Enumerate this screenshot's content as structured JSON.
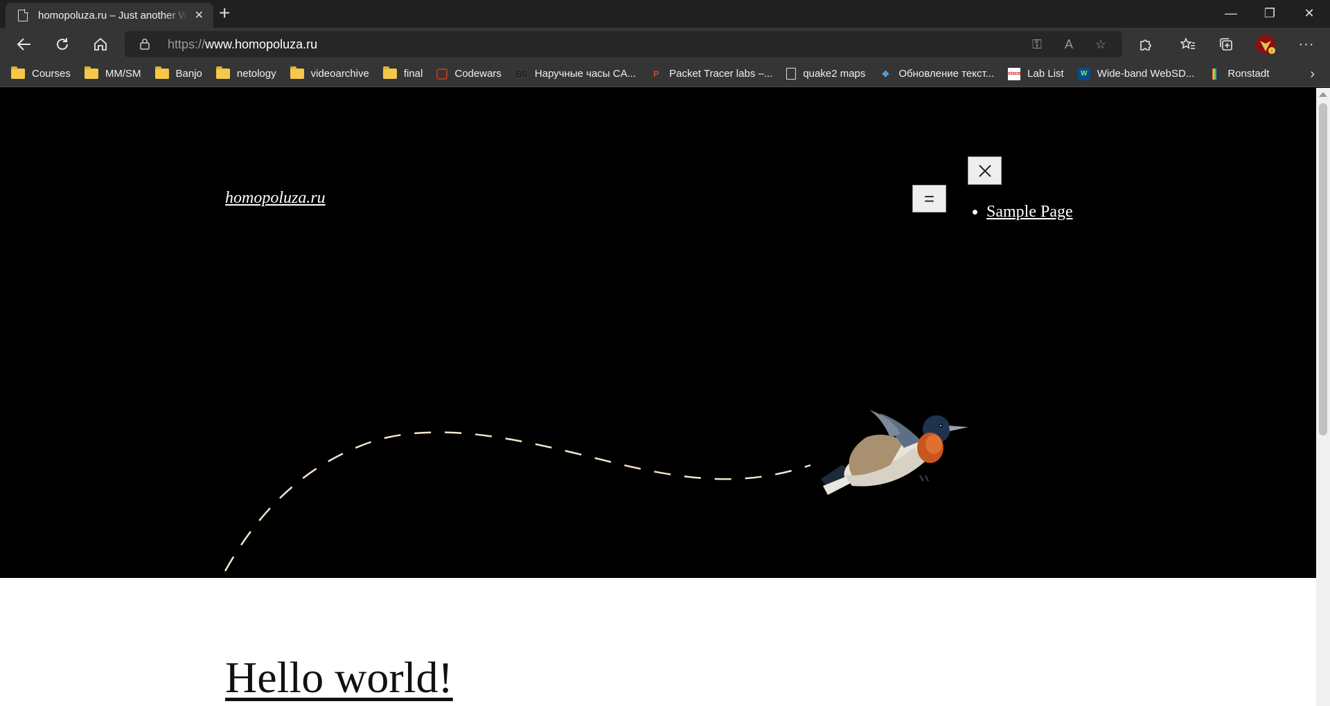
{
  "browser": {
    "tab": {
      "title": "homopoluza.ru – Just another WordPress site"
    },
    "url": {
      "protocol": "https://",
      "host": "www.homopoluza.ru"
    },
    "bookmarks": [
      {
        "label": "Courses",
        "icon": "folder-icon"
      },
      {
        "label": "MM/SM",
        "icon": "folder-icon"
      },
      {
        "label": "Banjo",
        "icon": "folder-icon"
      },
      {
        "label": "netology",
        "icon": "folder-icon"
      },
      {
        "label": "videoarchive",
        "icon": "folder-icon"
      },
      {
        "label": "final",
        "icon": "folder-icon"
      },
      {
        "label": "Codewars",
        "icon": "codewars-icon"
      },
      {
        "label": "Наручные часы CA...",
        "icon": "bs-icon"
      },
      {
        "label": "Packet Tracer labs –...",
        "icon": "packet-tracer-icon"
      },
      {
        "label": "quake2 maps",
        "icon": "page-icon"
      },
      {
        "label": "Обновление текст...",
        "icon": "puzzle-icon"
      },
      {
        "label": "Lab List",
        "icon": "cisco-icon"
      },
      {
        "label": "Wide-band WebSD...",
        "icon": "websdr-icon"
      },
      {
        "label": "Ronstadt",
        "icon": "ronstadt-icon"
      }
    ]
  },
  "page": {
    "site_title": "homopoluza.ru",
    "nav": {
      "items": [
        "Sample Page"
      ]
    },
    "post_title": "Hello world!"
  },
  "colors": {
    "chrome_dark": "#202020",
    "toolbar": "#353535",
    "hero_background": "#000000",
    "dash_line": "#f5e6cc"
  }
}
